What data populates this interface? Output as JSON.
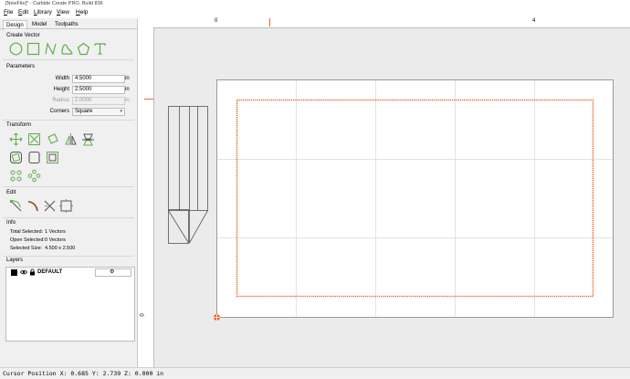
{
  "window": {
    "title": "[NewFile]* - Carbide Create PRO, Build 836"
  },
  "menu": {
    "items": [
      "File",
      "Edit",
      "Library",
      "View",
      "Help"
    ]
  },
  "tabs": [
    {
      "label": "Design",
      "active": true
    },
    {
      "label": "Model",
      "active": false
    },
    {
      "label": "Toolpaths",
      "active": false
    }
  ],
  "create_vector": {
    "title": "Create Vector",
    "tools": [
      "circle-icon",
      "rectangle-icon",
      "polyline-icon",
      "curve-icon",
      "polygon-icon",
      "text-icon"
    ]
  },
  "parameters": {
    "title": "Parameters",
    "width": {
      "label": "Width",
      "value": "4.5000",
      "unit": "in"
    },
    "height": {
      "label": "Height",
      "value": "2.5000",
      "unit": "in"
    },
    "radius": {
      "label": "Radius",
      "value": "2.0000",
      "unit": "in",
      "disabled": true
    },
    "corners": {
      "label": "Corners",
      "value": "Square"
    }
  },
  "transform": {
    "title": "Transform",
    "tools": [
      "move-icon",
      "scale-icon",
      "rotate-icon",
      "mirror-icon",
      "align-icon",
      "offset-icon",
      "join-icon",
      "boolean-icon",
      "array-icon",
      "circular-array-icon"
    ]
  },
  "edit": {
    "title": "Edit",
    "tools": [
      "node-edit-icon",
      "trim-icon",
      "cut-icon",
      "box-select-icon"
    ]
  },
  "info": {
    "title": "Info",
    "total_selected_label": "Total Selected:",
    "total_selected_value": "1 Vectors",
    "open_selected_label": "Open Selected:",
    "open_selected_value": "0 Vectors",
    "selected_size_label": "Selected Size:",
    "selected_size_value": "4.500 x 2.500"
  },
  "layers": {
    "title": "Layers",
    "items": [
      {
        "name": "DEFAULT",
        "color": "#000000"
      }
    ]
  },
  "rulers": {
    "top": [
      "0",
      "4"
    ],
    "left": [
      "0"
    ]
  },
  "status": {
    "text": "Cursor Position X: 0.685 Y: 2.739 Z: 0.000 in"
  },
  "colors": {
    "tool_green": "#5fae4a",
    "selection_orange": "#e8672c",
    "stock_bg": "#ffffff",
    "canvas_bg": "#ebebeb"
  }
}
